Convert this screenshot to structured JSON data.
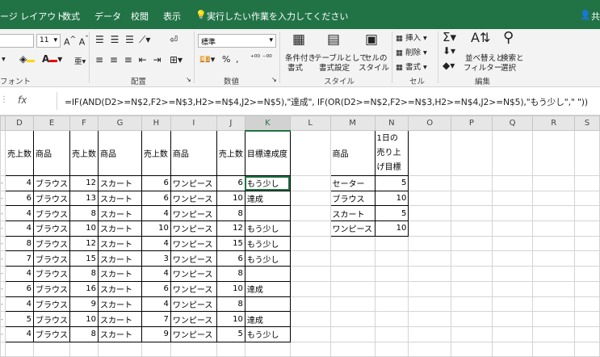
{
  "menu_tabs": [
    "ージ レイアウト",
    "数式",
    "データ",
    "校閲",
    "表示"
  ],
  "tell_me": "実行したい作業を入力してください",
  "share": "共",
  "ribbon": {
    "font_size": "11",
    "font_group": "フォント",
    "align_group": "配置",
    "number_format": "標準",
    "number_group": "数値",
    "style_group": "スタイル",
    "cells_group": "セル",
    "edit_group": "編集",
    "conditional_format": [
      "条件付き",
      "書式"
    ],
    "table_format": [
      "テーブルとして",
      "書式設定"
    ],
    "cell_style": [
      "セルの",
      "スタイル"
    ],
    "insert": "挿入",
    "delete": "削除",
    "format": "書式",
    "sort_filter": [
      "並べ替えと",
      "フィルター"
    ],
    "find_select": [
      "検索と",
      "選択"
    ]
  },
  "formula_bar": {
    "fx": "fx",
    "formula": "=IF(AND(D2>=N$2,F2>=N$3,H2>=N$4,J2>=N$5),\"達成\", IF(OR(D2>=N$2,F2>=N$3,H2>=N$4,J2>=N$5),\"もう少し\",\" \"))"
  },
  "columns": [
    "D",
    "E",
    "F",
    "G",
    "H",
    "I",
    "J",
    "K",
    "L",
    "M",
    "N",
    "O",
    "P",
    "Q",
    "R",
    "S"
  ],
  "header_row": [
    "売上数",
    "商品",
    "売上数",
    "商品",
    "売上数",
    "商品",
    "売上数",
    "目標達成度"
  ],
  "rows": [
    [
      "4",
      "ブラウス",
      "12",
      "スカート",
      "6",
      "ワンピース",
      "6",
      "もう少し"
    ],
    [
      "6",
      "ブラウス",
      "13",
      "スカート",
      "6",
      "ワンピース",
      "10",
      "達成"
    ],
    [
      "4",
      "ブラウス",
      "8",
      "スカート",
      "4",
      "ワンピース",
      "8",
      ""
    ],
    [
      "4",
      "ブラウス",
      "10",
      "スカート",
      "10",
      "ワンピース",
      "12",
      "もう少し"
    ],
    [
      "8",
      "ブラウス",
      "12",
      "スカート",
      "4",
      "ワンピース",
      "15",
      "もう少し"
    ],
    [
      "7",
      "ブラウス",
      "15",
      "スカート",
      "3",
      "ワンピース",
      "6",
      "もう少し"
    ],
    [
      "4",
      "ブラウス",
      "8",
      "スカート",
      "4",
      "ワンピース",
      "8",
      ""
    ],
    [
      "6",
      "ブラウス",
      "16",
      "スカート",
      "6",
      "ワンピース",
      "10",
      "達成"
    ],
    [
      "4",
      "ブラウス",
      "9",
      "スカート",
      "4",
      "ワンピース",
      "8",
      ""
    ],
    [
      "5",
      "ブラウス",
      "10",
      "スカート",
      "7",
      "ワンピース",
      "10",
      "達成"
    ],
    [
      "4",
      "ブラウス",
      "8",
      "スカート",
      "9",
      "ワンピース",
      "5",
      "もう少し"
    ]
  ],
  "target_table": {
    "header_label": "商品",
    "header_target": [
      "1日の",
      "売り上",
      "げ目標"
    ],
    "rows": [
      [
        "セーター",
        "5"
      ],
      [
        "ブラウス",
        "10"
      ],
      [
        "スカート",
        "5"
      ],
      [
        "ワンピース",
        "10"
      ]
    ]
  }
}
